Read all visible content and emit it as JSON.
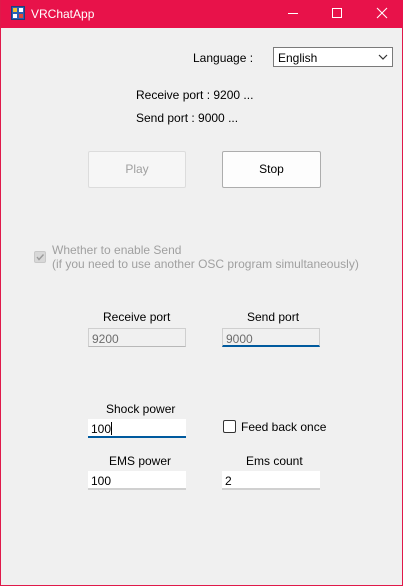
{
  "window": {
    "title": "VRChatApp"
  },
  "language": {
    "label": "Language :",
    "selected": "English"
  },
  "status": {
    "receive_port_text": "Receive port : 9200 ...",
    "send_port_text": "Send port : 9000 ..."
  },
  "buttons": {
    "play": "Play",
    "stop": "Stop"
  },
  "enable_send": {
    "line1": "Whether to enable Send",
    "line2": "(if you need to use another OSC program simultaneously)",
    "checked": true,
    "enabled": false
  },
  "ports": {
    "receive_label": "Receive port",
    "receive_value": "9200",
    "send_label": "Send port",
    "send_value": "9000"
  },
  "shock": {
    "label": "Shock power",
    "value": "100"
  },
  "feedback": {
    "label": "Feed back once",
    "checked": false
  },
  "ems": {
    "power_label": "EMS power",
    "power_value": "100",
    "count_label": "Ems count",
    "count_value": "2"
  },
  "colors": {
    "titlebar": "#e8124a",
    "focus_accent": "#005a9e"
  }
}
